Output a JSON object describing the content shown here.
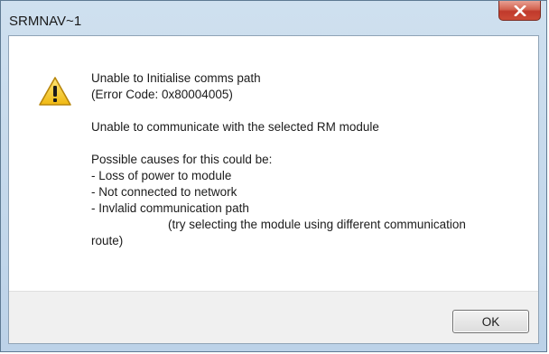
{
  "window": {
    "title": "SRMNAV~1"
  },
  "titlebar": {
    "close_icon": "close-icon",
    "close_color": "#c0392b"
  },
  "dialog": {
    "icon": "warning-icon",
    "icon_color": "#f3c623",
    "lines": {
      "l1": "Unable to Initialise comms path",
      "l2": " (Error Code: 0x80004005)",
      "l3": "Unable to communicate with the selected RM module",
      "l4": "Possible causes for this could be:",
      "l5": " - Loss of power to module",
      "l6": " - Not connected to network",
      "l7": " - Invlalid communication path",
      "l8": "(try selecting the module using different communication",
      "l9": "route)"
    }
  },
  "footer": {
    "ok_label": "OK"
  }
}
